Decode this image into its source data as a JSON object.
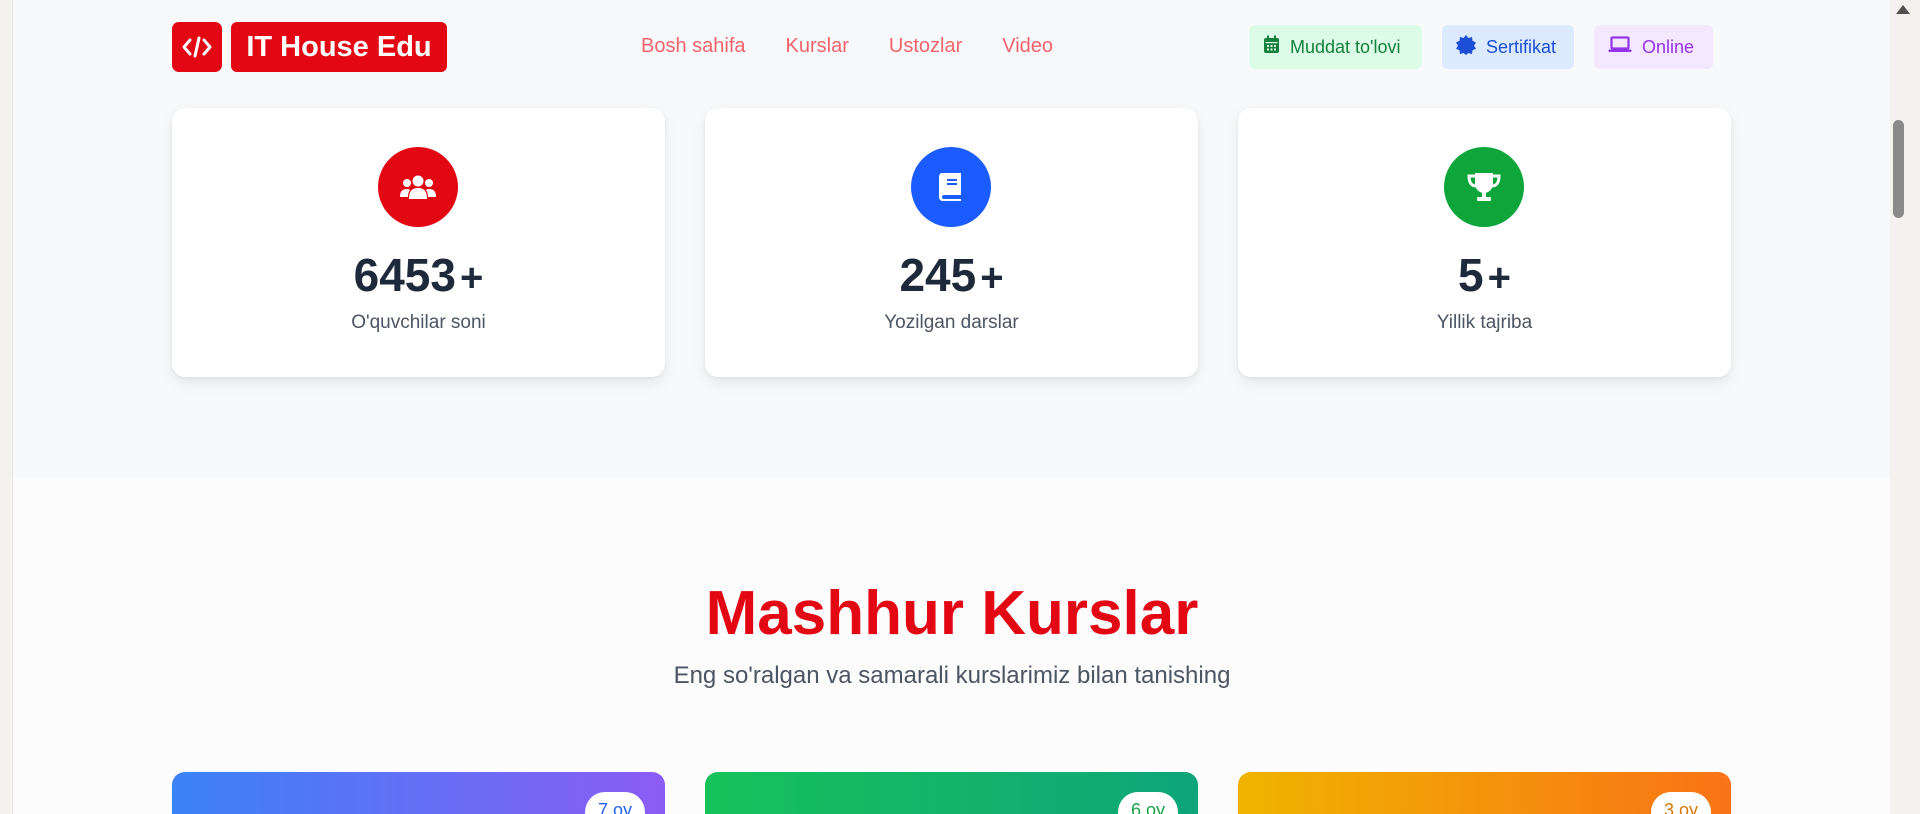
{
  "navbar": {
    "logo_text": "IT House Edu",
    "links": [
      "Bosh sahifa",
      "Kurslar",
      "Ustozlar",
      "Video"
    ],
    "badges": {
      "payment": "Muddat to'lovi",
      "certificate": "Sertifikat",
      "online": "Online"
    }
  },
  "stats": [
    {
      "value": "6453",
      "suffix": "+",
      "label": "O'quvchilar soni",
      "icon": "users-icon",
      "color": "#e30613"
    },
    {
      "value": "245",
      "suffix": "+",
      "label": "Yozilgan darslar",
      "icon": "book-icon",
      "color": "#1a5cff"
    },
    {
      "value": "5",
      "suffix": "+",
      "label": "Yillik tajriba",
      "icon": "trophy-icon",
      "color": "#0ea63a"
    }
  ],
  "courses_section": {
    "title": "Mashhur Kurslar",
    "subtitle": "Eng so'ralgan va samarali kurslarimiz bilan tanishing",
    "cards": [
      {
        "duration": "7 oy"
      },
      {
        "duration": "6 oy"
      },
      {
        "duration": "3 oy"
      }
    ]
  },
  "colors": {
    "brand": "#e30613",
    "nav_link": "#f0646c",
    "text_dark": "#1e293b"
  }
}
